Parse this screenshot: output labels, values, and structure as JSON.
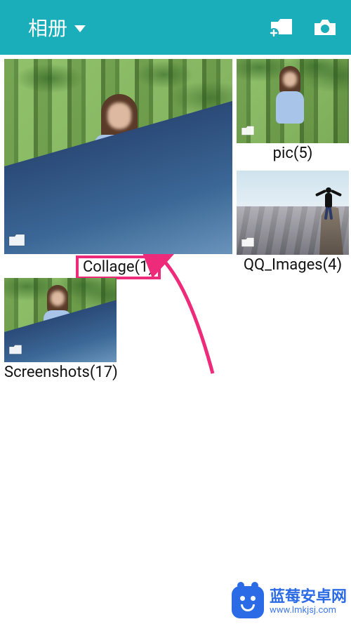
{
  "header": {
    "title": "相册",
    "icons": {
      "dropdown": "dropdown-caret-icon",
      "new_folder": "new-folder-icon",
      "camera": "camera-icon"
    }
  },
  "albums": [
    {
      "id": "collage",
      "label": "Collage(1)",
      "size": "large",
      "highlighted": true,
      "folder_badge": true
    },
    {
      "id": "pic",
      "label": "pic(5)",
      "size": "small",
      "highlighted": false,
      "folder_badge": true
    },
    {
      "id": "qq_images",
      "label": "QQ_Images(4)",
      "size": "small",
      "highlighted": false,
      "folder_badge": true
    },
    {
      "id": "screenshots",
      "label": "Screenshots(17)",
      "size": "small",
      "highlighted": false,
      "folder_badge": true
    }
  ],
  "annotation": {
    "arrow_color": "#ee2a7b"
  },
  "watermark": {
    "line1": "蓝莓安卓网",
    "line2": "www.lmkjsj.com"
  }
}
